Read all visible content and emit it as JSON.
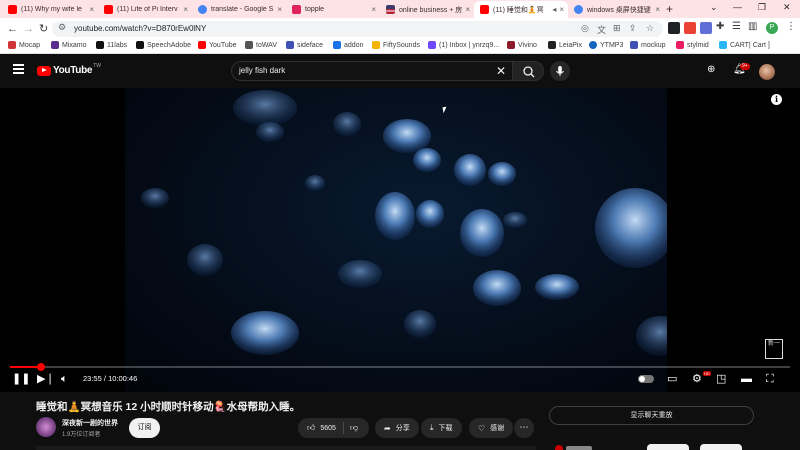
{
  "browser": {
    "tabs": [
      {
        "label": "(11) Why my wife le",
        "favicon": "youtube",
        "color": "#ff0000",
        "active": false
      },
      {
        "label": "(11) Life of Pi Interv",
        "favicon": "youtube",
        "color": "#ff0000",
        "active": false
      },
      {
        "label": "translate - Google S",
        "favicon": "google",
        "color": "#4285f4",
        "active": false
      },
      {
        "label": "topple",
        "favicon": "topple",
        "color": "#e0245e",
        "active": false
      },
      {
        "label": "online business + 房",
        "favicon": "us-flag",
        "color": "#3c3b6e",
        "active": false
      },
      {
        "label": "(11) 睡觉和🧘冥",
        "favicon": "youtube",
        "color": "#ff0000",
        "active": true
      },
      {
        "label": "windows 桌屏快捷键",
        "favicon": "google",
        "color": "#4285f4",
        "active": false
      }
    ],
    "tab_close_glyph": "×",
    "new_tab_glyph": "+",
    "window_controls": [
      "⌄",
      "—",
      "❐",
      "✕"
    ],
    "url": "youtube.com/watch?v=D870rEw0lNY",
    "bookmarks": [
      {
        "label": "Mocap",
        "color": "#d13438"
      },
      {
        "label": "Mixamo",
        "color": "#5c2d91"
      },
      {
        "label": "11labs",
        "color": "#111111"
      },
      {
        "label": "SpeechAdobe",
        "color": "#111111"
      },
      {
        "label": "YouTube",
        "color": "#ff0000"
      },
      {
        "label": "toWAV",
        "color": "#555555"
      },
      {
        "label": "sideface",
        "color": "#3f51b5"
      },
      {
        "label": "addon",
        "color": "#1a73e8"
      },
      {
        "label": "FiftySounds",
        "color": "#f4b400"
      },
      {
        "label": "(1) Inbox | ynrzq9...",
        "color": "#6d4aff"
      },
      {
        "label": "Vivino",
        "color": "#8b1a2b"
      },
      {
        "label": "LeiaPix",
        "color": "#222222"
      },
      {
        "label": "YTMP3",
        "color": "#1565c0"
      },
      {
        "label": "mockup",
        "color": "#3f51b5"
      },
      {
        "label": "stylmid",
        "color": "#e91e63"
      },
      {
        "label": "CART| Cart ]",
        "color": "#29b6f6"
      }
    ]
  },
  "youtube": {
    "logo_text": "YouTube",
    "logo_region": "TW",
    "search_query": "jelly fish dark",
    "notification_count": "9+",
    "extension_label": "1b",
    "video": {
      "title": "睡觉和🧘冥想音乐 12 小时顺时针移动🪼水母帮助入睡。",
      "current_time": "23:55",
      "separator": "/",
      "duration": "10:00:46",
      "progress_fraction": 0.0397,
      "watermark_text": "新一",
      "hd_badge": "HD"
    },
    "channel": {
      "name": "深夜新一剧的世界",
      "subscribers": "1.9万位订阅者",
      "subscribe_label": "订阅"
    },
    "actions": {
      "like_count": "5605",
      "share_label": "分享",
      "download_label": "下载",
      "thanks_label": "感谢",
      "more_glyph": "⋯"
    },
    "live_chat_label": "显示聊天重放"
  },
  "colors": {
    "youtube_red": "#ff0000",
    "tab_strip": "#fde2e6",
    "dark_bg": "#0f0f0f"
  }
}
